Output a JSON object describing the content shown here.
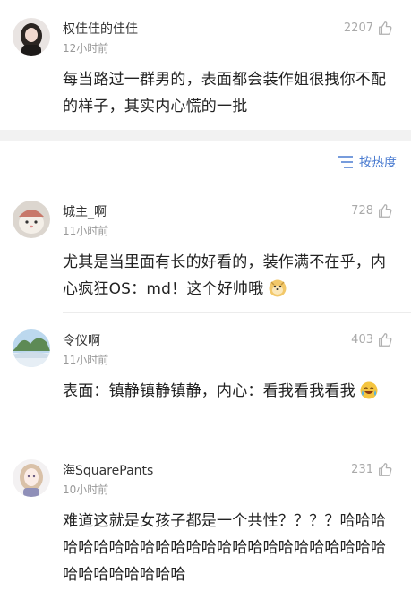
{
  "top_comment": {
    "username": "权佳佳的佳佳",
    "time": "12小时前",
    "likes": "2207",
    "text": "每当路过一群男的，表面都会装作姐很拽你不配的样子，其实内心慌的一批"
  },
  "sort": {
    "label": "按热度",
    "icon": "sort-lines-icon"
  },
  "comments": [
    {
      "username": "城主_啊",
      "time": "11小时前",
      "likes": "728",
      "text": "尤其是当里面有长的好看的，装作满不在乎，内心疯狂OS：md！这个好帅哦",
      "emoji": "doge-emoji"
    },
    {
      "username": "令仪啊",
      "time": "11小时前",
      "likes": "403",
      "text": "表面：镇静镇静镇静，内心：看我看我看我",
      "emoji": "laugh-cry-emoji"
    },
    {
      "username": "海SquarePants",
      "time": "10小时前",
      "likes": "231",
      "text": "难道这就是女孩子都是一个共性？？？？哈哈哈哈哈哈哈哈哈哈哈哈哈哈哈哈哈哈哈哈哈哈哈哈哈哈哈哈哈哈哈哈"
    }
  ],
  "colors": {
    "link_blue": "#4a7bd0",
    "muted": "#999999",
    "divider": "#ececec"
  }
}
